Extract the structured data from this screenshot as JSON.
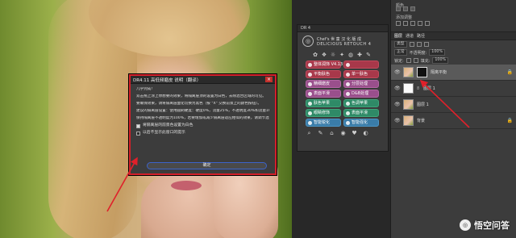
{
  "dialog": {
    "title": "DR4.11 高低频磨皮 说明（翻译）",
    "close_label": "×",
    "paragraphs": [
      "几乎完成!",
      "双击拖上涂上你想要的效果，将隔离层顶的设置为白色，去除混合区域的可见。",
      "要确保效果，请将隔离层面化切换为黑色（按 \"X\" 交换前景上的颜色按钮）。",
      "建议的隔离层设置：使用圆刷硬度：硬度0%，流量25%，不透明度30%和流量10%。",
      "保持隔离层不透明度为100%，若要增加或减少隔离层适应相似的效果，请调节混合器层。"
    ],
    "checkbox1_label": "将隔离层的前景色设置为白色",
    "checkbox2_label": "以后不显示此窗口的提示",
    "ok_label": "确定"
  },
  "dr4": {
    "tab_label": "DR 4",
    "brand_line1": "Chef's 世 童 汉 化 版 成",
    "brand_line2": "DELICIOUS RETOUCH 4",
    "logo_glyph": "◎",
    "top_icons": [
      "✿",
      "❖",
      "☼",
      "✦",
      "◍",
      "✚",
      "✎"
    ],
    "buttons": [
      {
        "label": "整体润饰 V4.13",
        "color": "red"
      },
      {
        "label": "",
        "color": "red"
      },
      {
        "label": "平衡肤色",
        "color": "red"
      },
      {
        "label": "单一肤色",
        "color": "red"
      },
      {
        "label": "精细磨皮",
        "color": "purple"
      },
      {
        "label": "分层处理",
        "color": "purple"
      },
      {
        "label": "表面平滑",
        "color": "purple"
      },
      {
        "label": "D&B处理",
        "color": "purple"
      },
      {
        "label": "肤色苹果",
        "color": "green"
      },
      {
        "label": "色调苹果",
        "color": "green"
      },
      {
        "label": "眼睛修饰",
        "color": "green"
      },
      {
        "label": "表面平滑",
        "color": "green"
      },
      {
        "label": "智能锐化",
        "color": "blue"
      },
      {
        "label": "智能强化",
        "color": "blue"
      }
    ],
    "bottom_icons": [
      "⌕",
      "✎",
      "⌂",
      "◉",
      "♥",
      "◐"
    ]
  },
  "layers": {
    "top_label": "颜色",
    "adjust_title": "添加调整",
    "tabs": [
      "图层",
      "通道",
      "路径"
    ],
    "kind_label": "类型",
    "blend_mode": "正常",
    "opacity_label": "不透明度:",
    "opacity_value": "100%",
    "lock_label": "锁定:",
    "fill_label": "填充:",
    "fill_value": "100%",
    "items": [
      {
        "name": "隔离平衡",
        "thumb": "black",
        "locked": true,
        "active": true,
        "mask": false
      },
      {
        "name": "图层 1",
        "thumb": "white",
        "locked": false,
        "active": false,
        "mask": true
      },
      {
        "name": "图层 1",
        "thumb": "photo",
        "locked": false,
        "active": false,
        "mask": false
      },
      {
        "name": "背景",
        "thumb": "photo",
        "locked": true,
        "active": false,
        "mask": false
      }
    ]
  },
  "watermark": {
    "logo_glyph": "◎",
    "text": "悟空问答"
  }
}
